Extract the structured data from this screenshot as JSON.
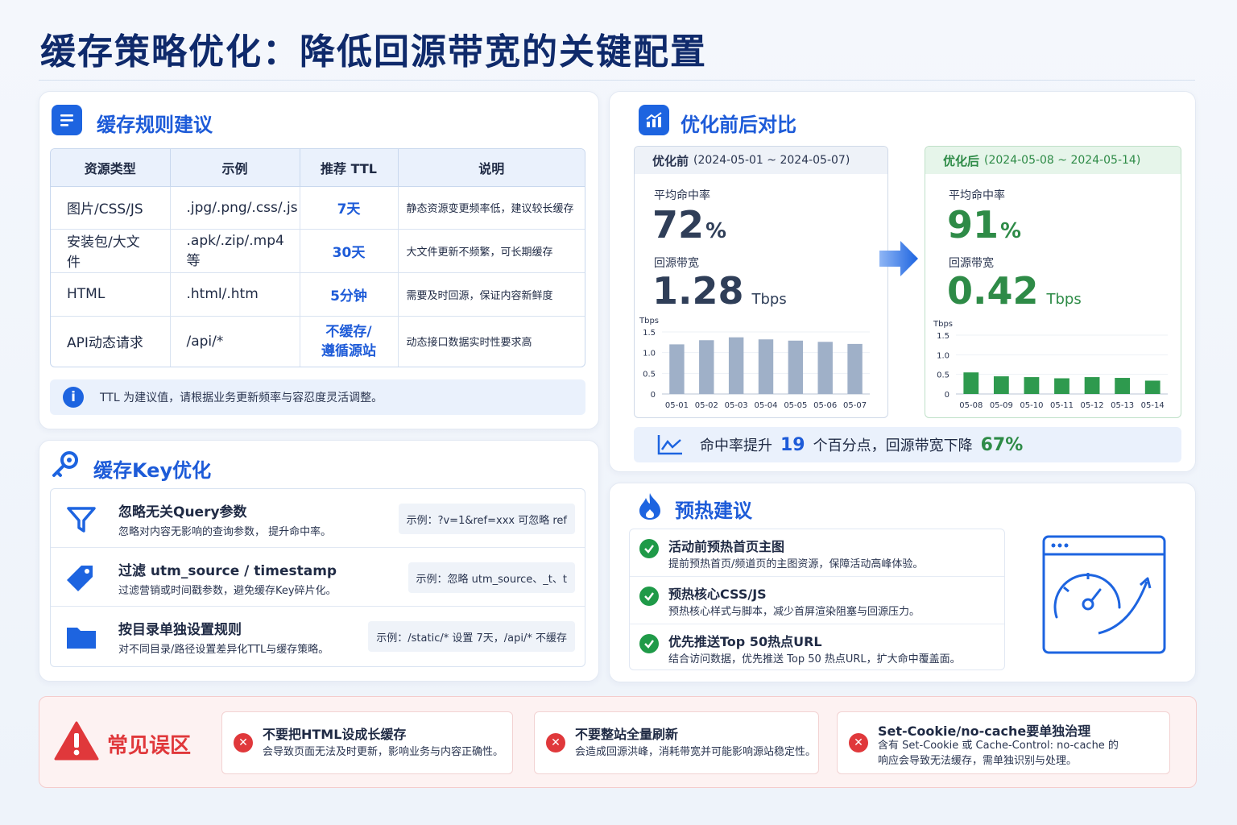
{
  "page": {
    "title": "缓存策略优化：降低回源带宽的关键配置"
  },
  "rules": {
    "heading": "缓存规则建议",
    "columns": [
      "资源类型",
      "示例",
      "推荐 TTL",
      "说明"
    ],
    "rows": [
      {
        "type": "图片/CSS/JS",
        "example": ".jpg/.png/.css/.js",
        "ttl": "7天",
        "desc": "静态资源变更频率低，建议较长缓存"
      },
      {
        "type": "安装包/大文件",
        "example": ".apk/.zip/.mp4等",
        "ttl": "30天",
        "desc": "大文件更新不频繁，可长期缓存"
      },
      {
        "type": "HTML",
        "example": ".html/.htm",
        "ttl": "5分钟",
        "desc": "需要及时回源，保证内容新鲜度"
      },
      {
        "type": "API动态请求",
        "example": "/api/*",
        "ttl": "不缓存/\n遵循源站",
        "desc": "动态接口数据实时性要求高"
      }
    ],
    "note": "TTL 为建议值，请根据业务更新频率与容忍度灵活调整。"
  },
  "cache_key": {
    "heading": "缓存Key优化",
    "items": [
      {
        "icon": "filter-icon",
        "title": "忽略无关Query参数",
        "sub": "忽略对内容无影响的查询参数，  提升命中率。",
        "example": "示例：?v=1&ref=xxx 可忽略 ref"
      },
      {
        "icon": "tag-icon",
        "title": "过滤 utm_source / timestamp",
        "sub": "过滤营销或时间戳参数，避免缓存Key碎片化。",
        "example": "示例：忽略 utm_source、_t、t"
      },
      {
        "icon": "folder-icon",
        "title": "按目录单独设置规则",
        "sub": "对不同目录/路径设置差异化TTL与缓存策略。",
        "example": "示例：/static/* 设置 7天，/api/* 不缓存"
      }
    ]
  },
  "compare": {
    "heading": "优化前后对比",
    "before": {
      "label": "优化前",
      "range": "(2024-05-01 ~ 2024-05-07)",
      "hit_label": "平均命中率",
      "hit_value": "72",
      "hit_unit": "%",
      "bw_label": "回源带宽",
      "bw_value": "1.28",
      "bw_unit": "Tbps"
    },
    "after": {
      "label": "优化后",
      "range": "(2024-05-08 ~ 2024-05-14)",
      "hit_label": "平均命中率",
      "hit_value": "91",
      "hit_unit": "%",
      "bw_label": "回源带宽",
      "bw_value": "0.42",
      "bw_unit": "Tbps"
    },
    "summary": {
      "prefix": "命中率提升",
      "points": "19",
      "middle": "个百分点，回源带宽下降",
      "drop": "67%"
    }
  },
  "chart_data": [
    {
      "type": "bar",
      "ylabel": "Tbps",
      "ylim": [
        0,
        1.5
      ],
      "yticks": [
        "0",
        "0.5",
        "1.0",
        "1.5"
      ],
      "categories": [
        "05-01",
        "05-02",
        "05-03",
        "05-04",
        "05-05",
        "05-06",
        "05-07"
      ],
      "values": [
        1.2,
        1.3,
        1.37,
        1.32,
        1.29,
        1.26,
        1.21
      ],
      "color": "#9fb0c8"
    },
    {
      "type": "bar",
      "ylabel": "Tbps",
      "ylim": [
        0,
        1.5
      ],
      "yticks": [
        "0",
        "0.5",
        "1.0",
        "1.5"
      ],
      "categories": [
        "05-08",
        "05-09",
        "05-10",
        "05-11",
        "05-12",
        "05-13",
        "05-14"
      ],
      "values": [
        0.55,
        0.45,
        0.43,
        0.4,
        0.43,
        0.41,
        0.34
      ],
      "color": "#2e9a4e"
    }
  ],
  "preheat": {
    "heading": "预热建议",
    "items": [
      {
        "title": "活动前预热首页主图",
        "sub": "提前预热首页/频道页的主图资源，保障活动高峰体验。"
      },
      {
        "title": "预热核心CSS/JS",
        "sub": "预热核心样式与脚本，减少首屏渲染阻塞与回源压力。"
      },
      {
        "title": "优先推送Top 50热点URL",
        "sub": "结合访问数据，优先推送 Top 50 热点URL，扩大命中覆盖面。"
      }
    ]
  },
  "pitfalls": {
    "heading": "常见误区",
    "items": [
      {
        "title": "不要把HTML设成长缓存",
        "sub": "会导致页面无法及时更新，影响业务与内容正确性。"
      },
      {
        "title": "不要整站全量刷新",
        "sub": "会造成回源洪峰，消耗带宽并可能影响源站稳定性。"
      },
      {
        "title": "Set-Cookie/no-cache要单独治理",
        "sub": "含有 Set-Cookie 或 Cache-Control: no-cache 的\n响应会导致无法缓存，需单独识别与处理。"
      }
    ]
  },
  "colors": {
    "brand_blue": "#1d5bd8",
    "success_green": "#2e8b47",
    "danger_red": "#e0383b"
  }
}
